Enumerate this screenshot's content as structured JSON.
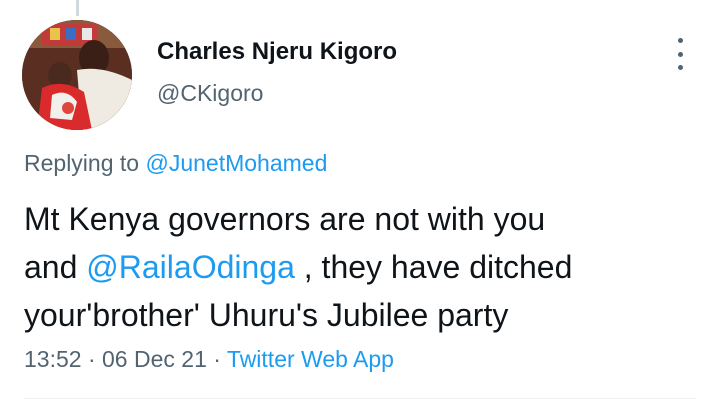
{
  "author": {
    "name": "Charles Njeru Kigoro",
    "handle": "@CKigoro"
  },
  "reply": {
    "prefix": "Replying to",
    "to": "@JunetMohamed"
  },
  "tweet": {
    "line1": "Mt Kenya governors are not with you",
    "line2_prefix": "and",
    "mention": "@RailaOdinga",
    "line2_suffix": ", they have ditched",
    "line3": "your'brother' Uhuru's Jubilee party"
  },
  "meta": {
    "time": "13:52",
    "sep1": "·",
    "date": "06 Dec 21",
    "sep2": "·",
    "source": "Twitter Web App"
  },
  "colors": {
    "link": "#1d9bf0",
    "muted": "#536471",
    "text": "#0f1419"
  },
  "icons": {
    "more": "more-vertical-icon"
  }
}
